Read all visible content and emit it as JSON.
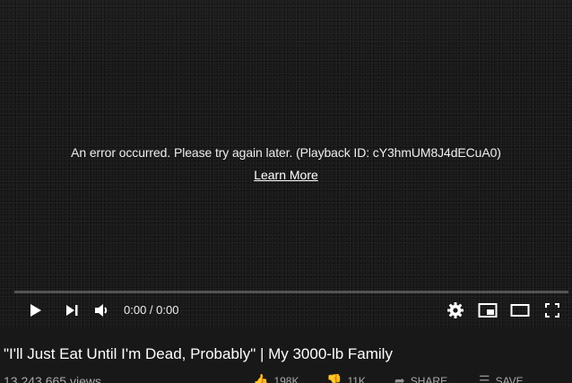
{
  "player": {
    "error_message": "An error occurred. Please try again later. (Playback ID: cY3hmUM8J4dECuA0)",
    "learn_more": "Learn More",
    "progress": 0,
    "time": "0:00 / 0:00",
    "icons": {
      "play": "play-icon",
      "next": "next-icon",
      "volume": "volume-icon",
      "settings": "gear-icon",
      "miniplayer": "miniplayer-icon",
      "theater": "theater-mode-icon",
      "fullscreen": "fullscreen-icon"
    }
  },
  "video": {
    "title": "\"I'll Just Eat Until I'm Dead, Probably\" | My 3000-lb Family",
    "views": "13,243,665 views",
    "likes": "198K",
    "dislikes": "11K",
    "share": "SHARE",
    "save": "SAVE"
  },
  "colors": {
    "background": "#181818",
    "progress_fill": "#ff0000"
  }
}
